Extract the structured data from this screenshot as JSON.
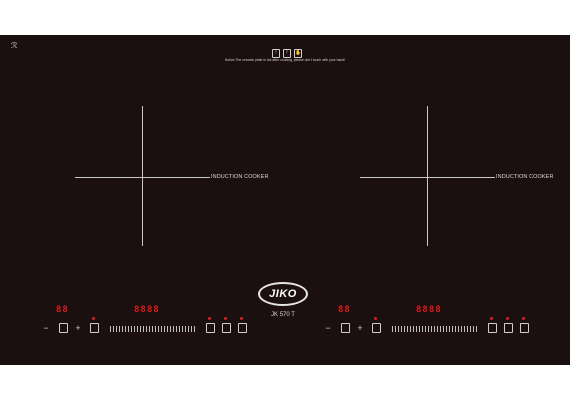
{
  "cooktop": {
    "logo_mark": "ℛ",
    "notice_icons": [
      "!",
      "!",
      "✋"
    ],
    "notice": "Notice:The ceramic plate is hot after cooking, please don't touch with your hand!",
    "brand": "JIKO",
    "model": "JK 570 T",
    "zones": [
      {
        "label": "INDUCTION COOKER",
        "timer": "88",
        "power": "8888",
        "minus": "−",
        "plus": "+"
      },
      {
        "label": "INDUCTION COOKER",
        "timer": "88",
        "power": "8888",
        "minus": "−",
        "plus": "+"
      }
    ],
    "icons": {
      "timer": "clock-icon",
      "lock": "lock-icon",
      "pause": "pause-icon",
      "play_pause": "play-pause-icon",
      "power": "power-icon"
    },
    "colors": {
      "glass": "#1b0f0f",
      "display": "#e01b1b",
      "lines": "#c9c9c9"
    }
  }
}
